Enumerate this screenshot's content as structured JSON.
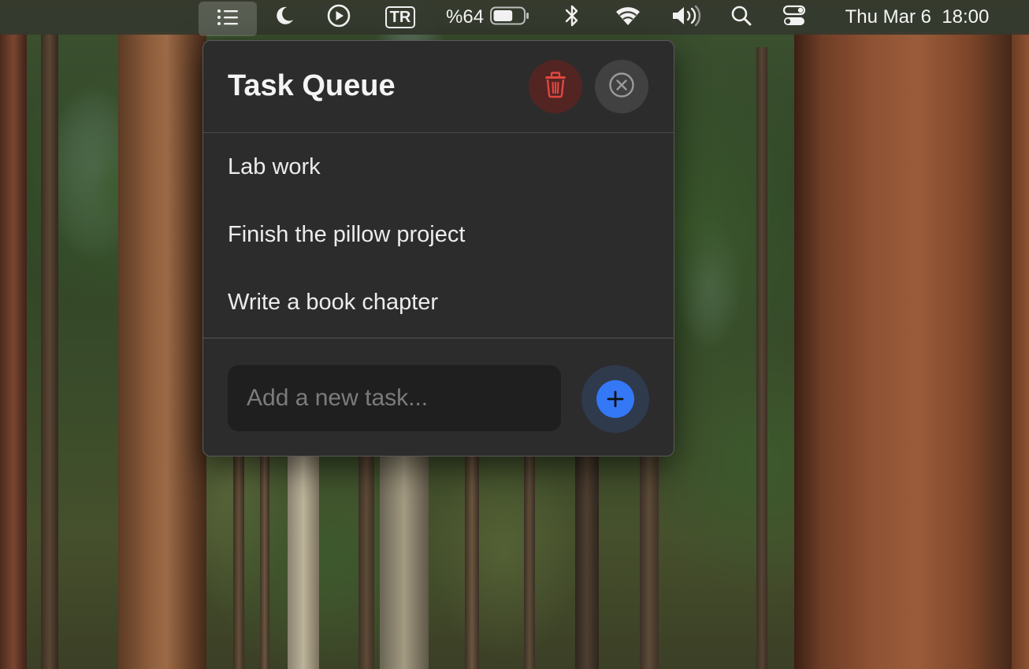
{
  "menubar": {
    "input_source": "TR",
    "battery_percent": "%64",
    "battery_level": 0.64,
    "datetime": "Thu Mar 6  18:00",
    "icons": [
      "list-icon",
      "moon-icon",
      "play-icon",
      "input-source-icon",
      "battery-icon",
      "bluetooth-icon",
      "wifi-icon",
      "volume-icon",
      "search-icon",
      "control-center-icon"
    ]
  },
  "popover": {
    "title": "Task Queue",
    "tasks": [
      {
        "label": "Lab work"
      },
      {
        "label": "Finish the pillow project"
      },
      {
        "label": "Write a book chapter"
      }
    ],
    "input": {
      "value": "",
      "placeholder": "Add a new task..."
    }
  },
  "colors": {
    "accent": "#3478f6",
    "danger": "#e0463f",
    "panel": "#2c2c2d"
  }
}
